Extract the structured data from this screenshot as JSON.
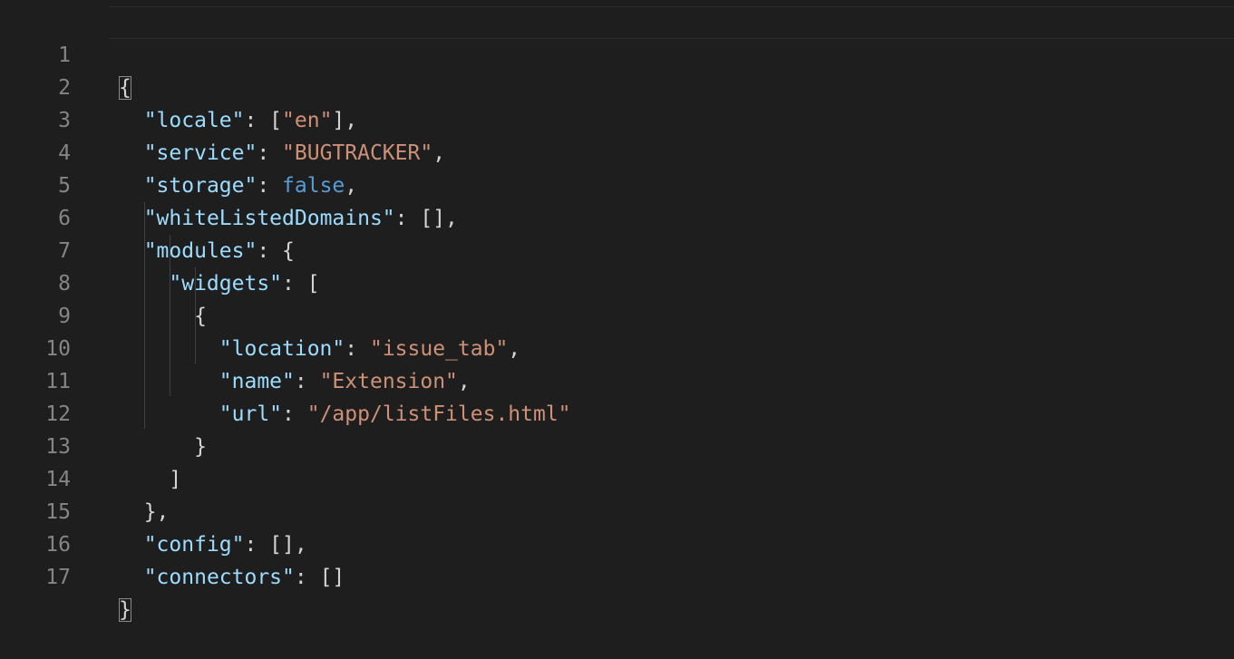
{
  "editor": {
    "lines": [
      {
        "n": "1",
        "t": [
          "{"
        ]
      },
      {
        "n": "2",
        "t": [
          "  ",
          "\"locale\"",
          ": [",
          "\"en\"",
          "],"
        ]
      },
      {
        "n": "3",
        "t": [
          "  ",
          "\"service\"",
          ": ",
          "\"BUGTRACKER\"",
          ","
        ]
      },
      {
        "n": "4",
        "t": [
          "  ",
          "\"storage\"",
          ": ",
          "false",
          ","
        ]
      },
      {
        "n": "5",
        "t": [
          "  ",
          "\"whiteListedDomains\"",
          ": [],"
        ]
      },
      {
        "n": "6",
        "t": [
          "  ",
          "\"modules\"",
          ": {"
        ]
      },
      {
        "n": "7",
        "t": [
          "    ",
          "\"widgets\"",
          ": ["
        ]
      },
      {
        "n": "8",
        "t": [
          "      ",
          "{"
        ]
      },
      {
        "n": "9",
        "t": [
          "        ",
          "\"location\"",
          ": ",
          "\"issue_tab\"",
          ","
        ]
      },
      {
        "n": "10",
        "t": [
          "        ",
          "\"name\"",
          ": ",
          "\"Extension\"",
          ","
        ]
      },
      {
        "n": "11",
        "t": [
          "        ",
          "\"url\"",
          ": ",
          "\"/app/listFiles.html\""
        ]
      },
      {
        "n": "12",
        "t": [
          "      ",
          "}"
        ]
      },
      {
        "n": "13",
        "t": [
          "    ",
          "]"
        ]
      },
      {
        "n": "14",
        "t": [
          "  ",
          "},"
        ]
      },
      {
        "n": "15",
        "t": [
          "  ",
          "\"config\"",
          ": [],"
        ]
      },
      {
        "n": "16",
        "t": [
          "  ",
          "\"connectors\"",
          ": []"
        ]
      },
      {
        "n": "17",
        "t": [
          "}"
        ]
      }
    ]
  },
  "colors": {
    "background": "#1e1e1e",
    "line_number": "#858585",
    "key": "#9cdcfe",
    "string": "#ce9178",
    "boolean": "#569cd6",
    "punctuation": "#d4d4d4"
  }
}
